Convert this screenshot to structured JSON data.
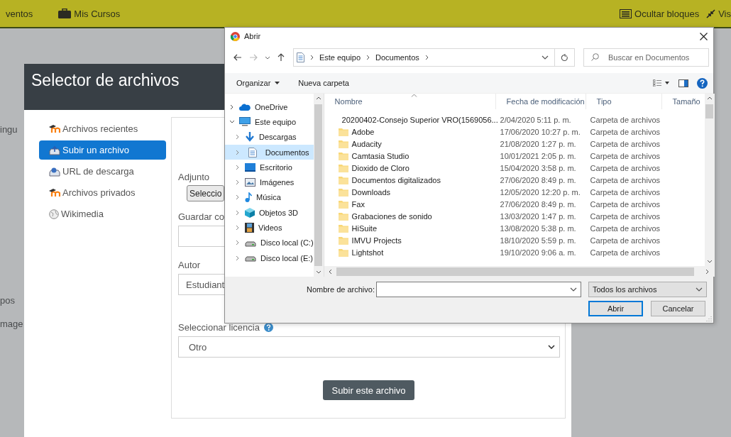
{
  "top_bar": {
    "left_items": [
      {
        "label": "ventos",
        "kind": "text"
      },
      {
        "label": "Mis Cursos",
        "kind": "briefcase"
      }
    ],
    "right_items": [
      {
        "label": "Ocultar bloques",
        "kind": "blocks"
      },
      {
        "label": "Vis",
        "kind": "expand"
      }
    ]
  },
  "background_page": {
    "fragments": [
      "ingu",
      "pos",
      "mage"
    ]
  },
  "file_picker": {
    "title": "Selector de archivos",
    "sources": [
      {
        "label": "Archivos recientes",
        "kind": "moodle",
        "selected": false
      },
      {
        "label": "Subir un archivo",
        "kind": "upload",
        "selected": true
      },
      {
        "label": "URL de descarga",
        "kind": "url",
        "selected": false
      },
      {
        "label": "Archivos privados",
        "kind": "moodle",
        "selected": false
      },
      {
        "label": "Wikimedia",
        "kind": "wiki",
        "selected": false
      }
    ],
    "form": {
      "attachment_label": "Adjunto",
      "choose_button": "Seleccio",
      "save_as_label": "Guardar co",
      "author_label": "Autor",
      "author_value": "Estudiant",
      "license_label": "Seleccionar licencia",
      "license_value": "Otro",
      "upload_button": "Subir este archivo"
    }
  },
  "open_dialog": {
    "title": "Abrir",
    "breadcrumb": [
      "Este equipo",
      "Documentos"
    ],
    "search": {
      "placeholder": "Buscar en Documentos"
    },
    "toolbar": [
      "Organizar",
      "Nueva carpeta"
    ],
    "tree": [
      {
        "label": "OneDrive",
        "kind": "cloud",
        "expanded": false,
        "selected": false
      },
      {
        "label": "Este equipo",
        "kind": "computer",
        "expanded": true,
        "selected": false,
        "children": [
          {
            "label": "Descargas",
            "kind": "download",
            "expanded": false,
            "selected": false
          },
          {
            "label": "Documentos",
            "kind": "document",
            "expanded": false,
            "selected": true
          },
          {
            "label": "Escritorio",
            "kind": "desktop",
            "expanded": false,
            "selected": false
          },
          {
            "label": "Imágenes",
            "kind": "images",
            "expanded": false,
            "selected": false
          },
          {
            "label": "Música",
            "kind": "music",
            "expanded": false,
            "selected": false
          },
          {
            "label": "Objetos 3D",
            "kind": "cube",
            "expanded": false,
            "selected": false
          },
          {
            "label": "Videos",
            "kind": "video",
            "expanded": false,
            "selected": false
          },
          {
            "label": "Disco local (C:)",
            "kind": "drive",
            "expanded": false,
            "selected": false
          },
          {
            "label": "Disco local (E:)",
            "kind": "drive",
            "expanded": false,
            "selected": false
          }
        ]
      }
    ],
    "columns": [
      "Nombre",
      "Fecha de modificación",
      "Tipo",
      "Tamaño"
    ],
    "files": [
      {
        "name": "20200402-Consejo Superior VRO(1569056...",
        "date": "2/04/2020 5:11 p. m.",
        "type": "Carpeta de archivos"
      },
      {
        "name": "Adobe",
        "date": "17/06/2020 10:27 p. m.",
        "type": "Carpeta de archivos"
      },
      {
        "name": "Audacity",
        "date": "21/08/2020 1:27 p. m.",
        "type": "Carpeta de archivos"
      },
      {
        "name": "Camtasia Studio",
        "date": "10/01/2021 2:05 p. m.",
        "type": "Carpeta de archivos"
      },
      {
        "name": "Dioxido de Cloro",
        "date": "15/04/2020 3:58 p. m.",
        "type": "Carpeta de archivos"
      },
      {
        "name": "Documentos digitalizados",
        "date": "27/06/2020 8:49 p. m.",
        "type": "Carpeta de archivos"
      },
      {
        "name": "Downloads",
        "date": "12/05/2020 12:20 p. m.",
        "type": "Carpeta de archivos"
      },
      {
        "name": "Fax",
        "date": "27/06/2020 8:49 p. m.",
        "type": "Carpeta de archivos"
      },
      {
        "name": "Grabaciones de sonido",
        "date": "13/03/2020 1:47 p. m.",
        "type": "Carpeta de archivos"
      },
      {
        "name": "HiSuite",
        "date": "13/08/2020 5:38 p. m.",
        "type": "Carpeta de archivos"
      },
      {
        "name": "IMVU Projects",
        "date": "18/10/2020 5:59 p. m.",
        "type": "Carpeta de archivos"
      },
      {
        "name": "Lightshot",
        "date": "19/10/2020 9:06 a. m.",
        "type": "Carpeta de archivos"
      }
    ],
    "filename_label": "Nombre de archivo:",
    "filter": "Todos los archivos",
    "buttons": [
      {
        "label": "Abrir",
        "selected": true
      },
      {
        "label": "Cancelar",
        "selected": false
      }
    ]
  }
}
